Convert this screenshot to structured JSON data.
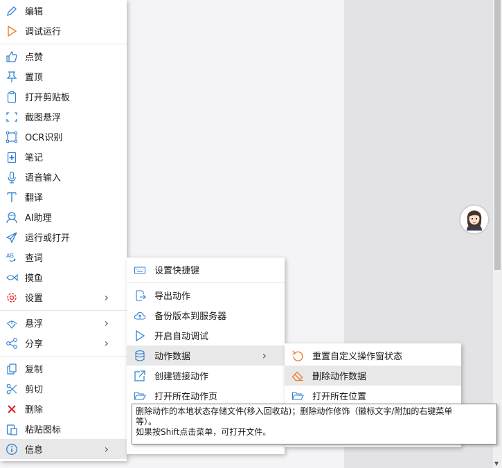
{
  "main_menu": {
    "items": [
      {
        "label": "编辑",
        "icon": "pencil-icon"
      },
      {
        "label": "调试运行",
        "icon": "play-icon"
      },
      {
        "label": "点赞",
        "icon": "thumbs-up-icon"
      },
      {
        "label": "置顶",
        "icon": "pin-icon"
      },
      {
        "label": "打开剪贴板",
        "icon": "clipboard-icon"
      },
      {
        "label": "截图悬浮",
        "icon": "screenshot-icon"
      },
      {
        "label": "OCR识别",
        "icon": "ocr-icon"
      },
      {
        "label": "笔记",
        "icon": "note-icon"
      },
      {
        "label": "语音输入",
        "icon": "microphone-icon"
      },
      {
        "label": "翻译",
        "icon": "translate-icon"
      },
      {
        "label": "AI助理",
        "icon": "ai-assistant-icon"
      },
      {
        "label": "运行或打开",
        "icon": "paper-plane-icon"
      },
      {
        "label": "查词",
        "icon": "dictionary-icon"
      },
      {
        "label": "摸鱼",
        "icon": "fish-icon"
      },
      {
        "label": "设置",
        "icon": "gear-icon"
      },
      {
        "label": "悬浮",
        "icon": "float-icon"
      },
      {
        "label": "分享",
        "icon": "share-icon"
      },
      {
        "label": "复制",
        "icon": "copy-icon"
      },
      {
        "label": "剪切",
        "icon": "scissors-icon"
      },
      {
        "label": "删除",
        "icon": "delete-x-icon"
      },
      {
        "label": "粘贴图标",
        "icon": "paste-icon"
      },
      {
        "label": "信息",
        "icon": "info-icon"
      }
    ]
  },
  "sub_menu": {
    "items": [
      {
        "label": "设置快捷键",
        "icon": "keyboard-icon"
      },
      {
        "label": "导出动作",
        "icon": "export-icon"
      },
      {
        "label": "备份版本到服务器",
        "icon": "cloud-upload-icon"
      },
      {
        "label": "开启自动调试",
        "icon": "play-outline-icon"
      },
      {
        "label": "动作数据",
        "icon": "database-icon"
      },
      {
        "label": "创建链接动作",
        "icon": "link-out-icon"
      },
      {
        "label": "打开所在动作页",
        "icon": "folder-open-icon"
      }
    ]
  },
  "data_menu": {
    "items": [
      {
        "label": "重置自定义操作窗状态",
        "icon": "reset-icon"
      },
      {
        "label": "删除动作数据",
        "icon": "eraser-icon"
      },
      {
        "label": "打开所在位置",
        "icon": "folder-icon"
      }
    ]
  },
  "tooltip": {
    "line1": "删除动作的本地状态存储文件(移入回收站)；删除动作修饰（徽标文字/附加的右键菜单",
    "line2": "等）。",
    "line3": "如果按Shift点击菜单，可打开文件。"
  },
  "colors": {
    "icon_blue": "#2b7fd4",
    "icon_orange": "#f07a2a",
    "icon_red": "#e02020"
  }
}
